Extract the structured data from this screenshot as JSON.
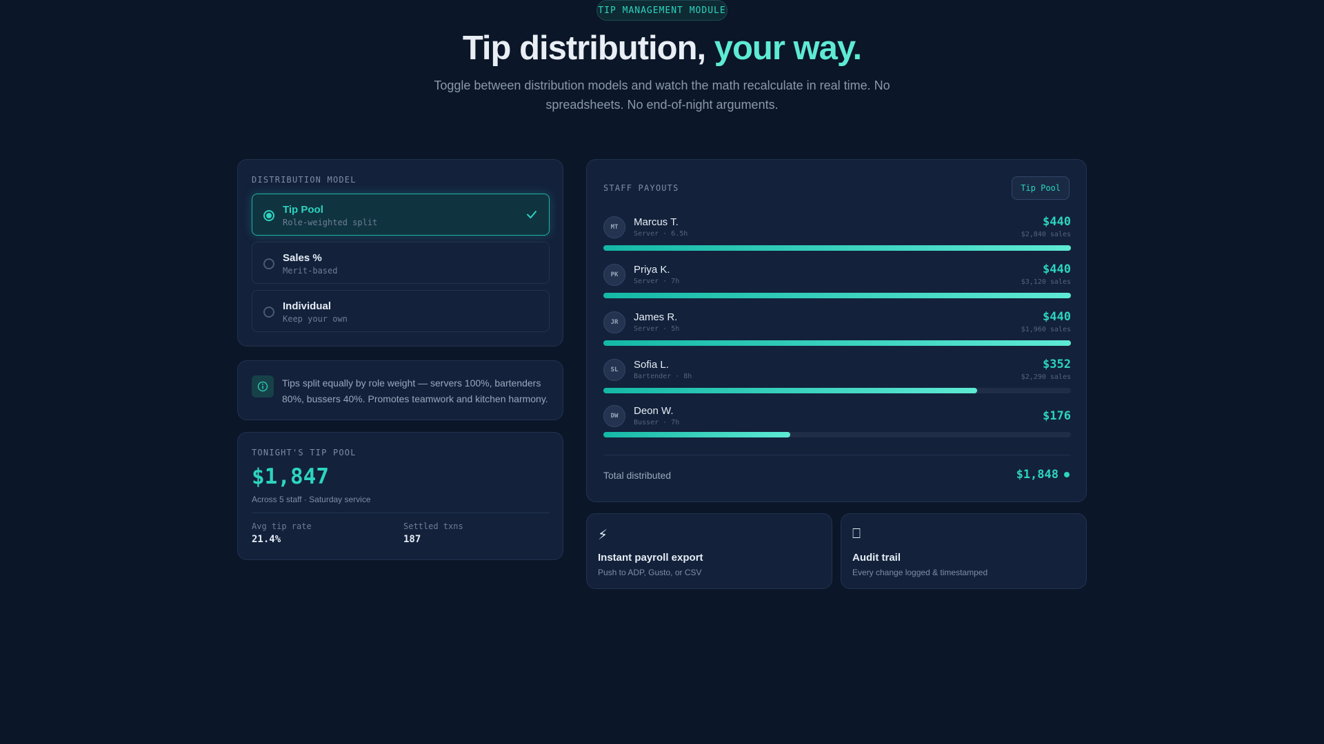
{
  "header": {
    "badge": "TIP MANAGEMENT MODULE",
    "title_main": "Tip distribution, ",
    "title_highlight": "your way.",
    "subtitle": "Toggle between distribution models and watch the math recalculate in real time. No spreadsheets. No end-of-night arguments."
  },
  "distribution": {
    "label": "DISTRIBUTION MODEL",
    "options": [
      {
        "title": "Tip Pool",
        "subtitle": "Role-weighted split",
        "selected": true
      },
      {
        "title": "Sales %",
        "subtitle": "Merit-based",
        "selected": false
      },
      {
        "title": "Individual",
        "subtitle": "Keep your own",
        "selected": false
      }
    ]
  },
  "info": {
    "icon": "info-icon",
    "text": "Tips split equally by role weight — servers 100%, bartenders 80%, bussers 40%. Promotes teamwork and kitchen harmony."
  },
  "pool": {
    "label": "TONIGHT'S TIP POOL",
    "amount": "$1,847",
    "subtitle": "Across 5 staff · Saturday service",
    "stats": [
      {
        "label": "Avg tip rate",
        "value": "21.4%"
      },
      {
        "label": "Settled txns",
        "value": "187"
      }
    ]
  },
  "payouts": {
    "label": "STAFF PAYOUTS",
    "mode_badge": "Tip Pool",
    "staff": [
      {
        "initials": "MT",
        "name": "Marcus T.",
        "role": "Server · 6.5h",
        "amount": "$440",
        "sales": "$2,840 sales",
        "share": 1.0
      },
      {
        "initials": "PK",
        "name": "Priya K.",
        "role": "Server · 7h",
        "amount": "$440",
        "sales": "$3,120 sales",
        "share": 1.0
      },
      {
        "initials": "JR",
        "name": "James R.",
        "role": "Server · 5h",
        "amount": "$440",
        "sales": "$1,960 sales",
        "share": 1.0
      },
      {
        "initials": "SL",
        "name": "Sofia L.",
        "role": "Bartender · 8h",
        "amount": "$352",
        "sales": "$2,290 sales",
        "share": 0.8
      },
      {
        "initials": "DW",
        "name": "Deon W.",
        "role": "Busser · 7h",
        "amount": "$176",
        "sales": "",
        "share": 0.4
      }
    ],
    "total_label": "Total distributed",
    "total_value": "$1,848"
  },
  "features": [
    {
      "icon": "lightning-icon",
      "glyph": "⚡",
      "title": "Instant payroll export",
      "subtitle": "Push to ADP, Gusto, or CSV"
    },
    {
      "icon": "clipboard-icon",
      "glyph": "⎕",
      "title": "Audit trail",
      "subtitle": "Every change logged & timestamped"
    }
  ],
  "colors": {
    "accent": "#2dd4bf",
    "background": "#0b1628",
    "card": "#13213b"
  }
}
